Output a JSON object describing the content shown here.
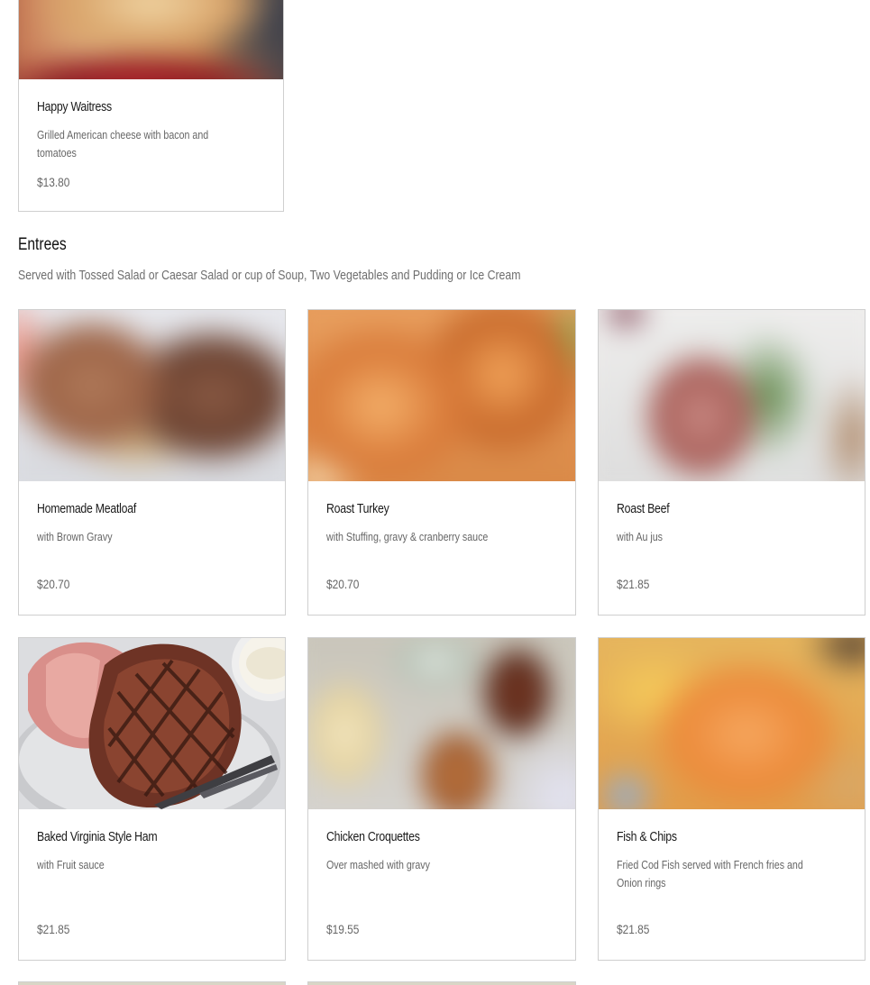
{
  "top_card": {
    "name": "Happy Waitress",
    "description": "Grilled American cheese with bacon and tomatoes",
    "price": "$13.80"
  },
  "section": {
    "title": "Entrees",
    "subtitle": "Served with Tossed Salad or Caesar Salad or cup of Soup, Two Vegetables and Pudding or Ice Cream"
  },
  "items": [
    {
      "name": "Homemade Meatloaf",
      "description": "with Brown Gravy",
      "price": "$20.70"
    },
    {
      "name": "Roast Turkey",
      "description": "with Stuffing, gravy & cranberry sauce",
      "price": "$20.70"
    },
    {
      "name": "Roast Beef",
      "description": "with Au jus",
      "price": "$21.85"
    },
    {
      "name": "Baked Virginia Style Ham",
      "description": "with Fruit sauce",
      "price": "$21.85"
    },
    {
      "name": "Chicken Croquettes",
      "description": "Over mashed with gravy",
      "price": "$19.55"
    },
    {
      "name": "Fish & Chips",
      "description": "Fried Cod Fish served with French fries and Onion rings",
      "price": "$21.85"
    }
  ]
}
